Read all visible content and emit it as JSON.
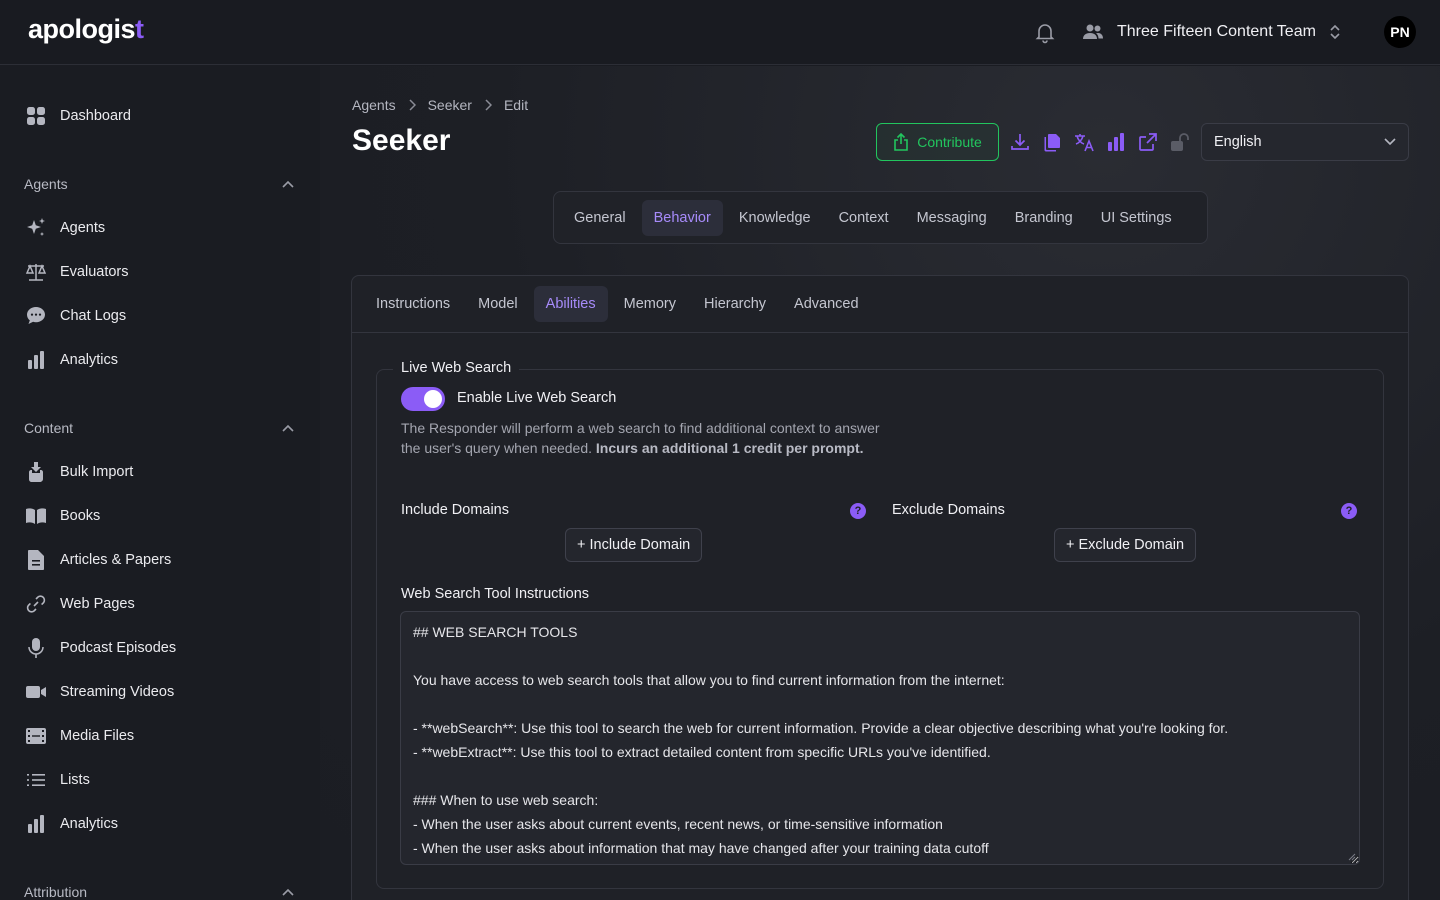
{
  "header": {
    "logo_text": "apologis",
    "logo_cross": "t",
    "team_name": "Three Fifteen Content Team",
    "avatar_initials": "PN"
  },
  "sidebar": {
    "dashboard": "Dashboard",
    "agents_section": "Agents",
    "agents_items": [
      "Agents",
      "Evaluators",
      "Chat Logs",
      "Analytics"
    ],
    "content_section": "Content",
    "content_items": [
      "Bulk Import",
      "Books",
      "Articles & Papers",
      "Web Pages",
      "Podcast Episodes",
      "Streaming Videos",
      "Media Files",
      "Lists",
      "Analytics"
    ],
    "attribution_section": "Attribution"
  },
  "breadcrumb": [
    "Agents",
    "Seeker",
    "Edit"
  ],
  "page_title": "Seeker",
  "toolbar": {
    "contribute_label": "Contribute",
    "language": "English"
  },
  "main_tabs": [
    "General",
    "Behavior",
    "Knowledge",
    "Context",
    "Messaging",
    "Branding",
    "UI Settings"
  ],
  "sub_tabs": [
    "Instructions",
    "Model",
    "Abilities",
    "Memory",
    "Hierarchy",
    "Advanced"
  ],
  "web_search": {
    "legend": "Live Web Search",
    "toggle_label": "Enable Live Web Search",
    "toggle_on": true,
    "description": "The Responder will perform a web search to find additional context to answer the user's query when needed.",
    "description_bold": "Incurs an additional 1 credit per prompt.",
    "include_label": "Include Domains",
    "include_button": "+ Include Domain",
    "exclude_label": "Exclude Domains",
    "exclude_button": "+ Exclude Domain",
    "instructions_label": "Web Search Tool Instructions",
    "instructions_lines": [
      "## WEB SEARCH TOOLS",
      "",
      "You have access to web search tools that allow you to find current information from the internet:",
      "",
      "- **webSearch**: Use this tool to search the web for current information. Provide a clear objective describing what you're looking for.",
      "- **webExtract**: Use this tool to extract detailed content from specific URLs you've identified.",
      "",
      "### When to use web search:",
      "- When the user asks about current events, recent news, or time-sensitive information",
      "- When the user asks about information that may have changed after your training data cutoff"
    ]
  },
  "colors": {
    "accent": "#8b5cf6",
    "contribute_green": "#22c55e",
    "background": "#1a1c22"
  }
}
